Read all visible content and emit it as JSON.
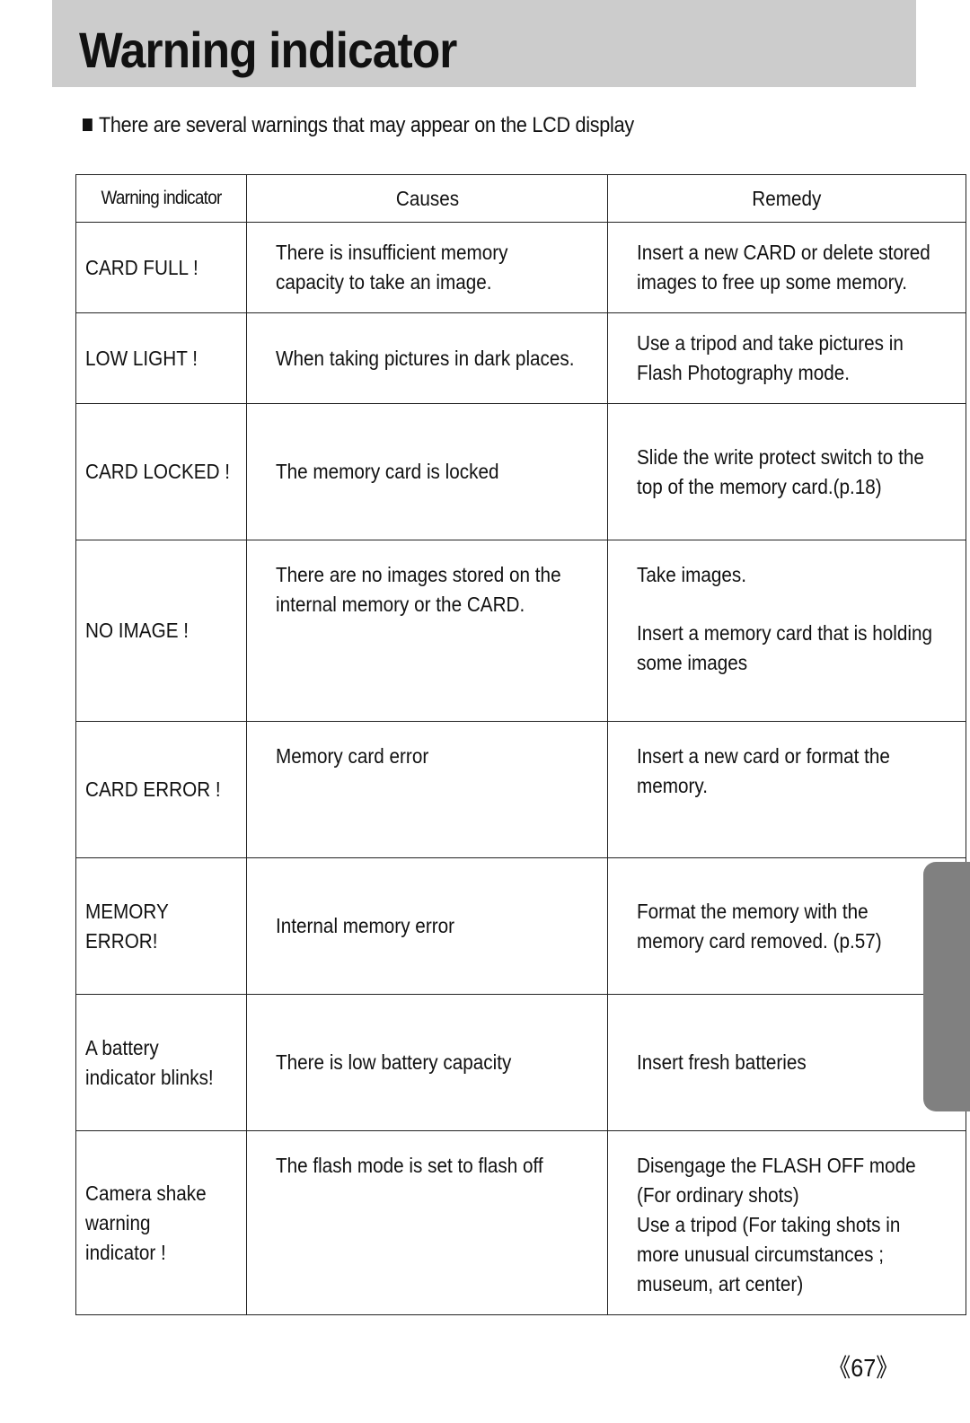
{
  "header": {
    "title": "Warning indicator"
  },
  "intro": {
    "bullet_icon": "black-square",
    "text": "There are several warnings that may appear on the LCD display"
  },
  "table": {
    "headers": [
      "Warning indicator",
      "Causes",
      "Remedy"
    ],
    "rows": [
      {
        "indicator": [
          "CARD FULL !"
        ],
        "causes": [
          "There is insufficient memory",
          "capacity to take an image."
        ],
        "remedy": [
          "Insert a new CARD or delete stored",
          "images to free up some memory."
        ]
      },
      {
        "indicator": [
          "LOW LIGHT !"
        ],
        "causes": [
          "When taking pictures in dark places."
        ],
        "remedy": [
          "Use a tripod and take pictures in",
          "Flash Photography mode."
        ]
      },
      {
        "indicator": [
          "CARD LOCKED !"
        ],
        "causes": [
          "The memory card is locked"
        ],
        "remedy": [
          "Slide the write protect switch to the",
          "top of the memory card.(p.18)"
        ]
      },
      {
        "indicator": [
          "NO IMAGE !"
        ],
        "causes": [
          "There are no images stored on the",
          "internal memory or the CARD."
        ],
        "remedy": [
          "Take images.",
          "",
          "Insert a memory card that is holding",
          "some images"
        ]
      },
      {
        "indicator": [
          "CARD ERROR !"
        ],
        "causes": [
          "Memory card error"
        ],
        "remedy": [
          "Insert a new card or format the",
          "memory."
        ]
      },
      {
        "indicator": [
          "MEMORY",
          "ERROR!"
        ],
        "causes": [
          "Internal memory error"
        ],
        "remedy": [
          "Format the memory with the",
          "memory card removed. (p.57)"
        ]
      },
      {
        "indicator": [
          "A battery",
          "indicator blinks!"
        ],
        "causes": [
          "There is low battery capacity"
        ],
        "remedy": [
          "Insert fresh batteries"
        ]
      },
      {
        "indicator": [
          "Camera shake",
          "warning",
          "indicator !"
        ],
        "causes": [
          "The flash mode is set to flash off"
        ],
        "remedy": [
          "Disengage the FLASH OFF mode",
          "(For ordinary shots)",
          "Use a tripod (For taking shots in",
          "more unusual circumstances ;",
          "museum, art center)"
        ]
      }
    ]
  },
  "footer": {
    "page_number": "《67》"
  }
}
